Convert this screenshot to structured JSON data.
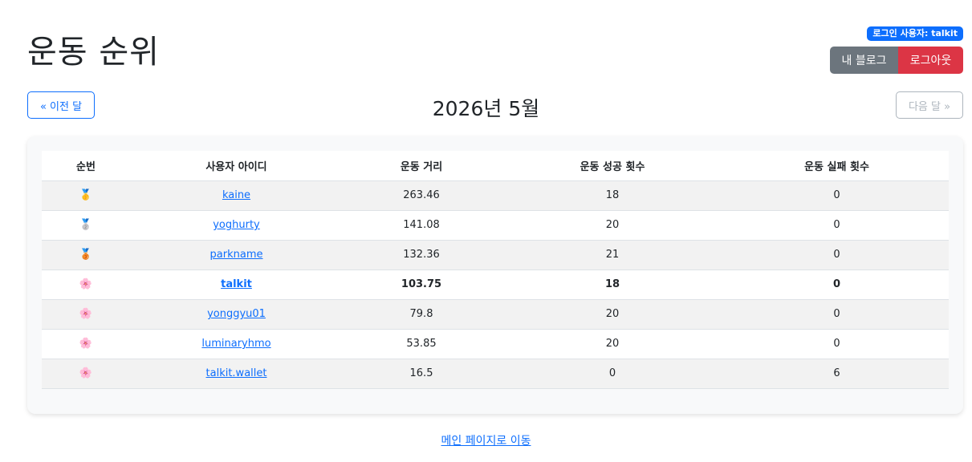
{
  "header": {
    "title": "운동 순위",
    "user_badge": "로그인 사용자: talkit",
    "blog_label": "내 블로그",
    "logout_label": "로그아웃"
  },
  "nav": {
    "prev_label": "« 이전 달",
    "month": "2026년 5월",
    "next_label": "다음 달 »"
  },
  "table": {
    "headers": [
      "순번",
      "사용자 아이디",
      "운동 거리",
      "운동 성공 횟수",
      "운동 실패 횟수"
    ],
    "rows": [
      {
        "rank": "🥇",
        "user": "kaine",
        "distance": "263.46",
        "success": "18",
        "fail": "0"
      },
      {
        "rank": "🥈",
        "user": "yoghurty",
        "distance": "141.08",
        "success": "20",
        "fail": "0"
      },
      {
        "rank": "🥉",
        "user": "parkname",
        "distance": "132.36",
        "success": "21",
        "fail": "0"
      },
      {
        "rank": "🌸",
        "user": "talkit",
        "distance": "103.75",
        "success": "18",
        "fail": "0"
      },
      {
        "rank": "🌸",
        "user": "yonggyu01",
        "distance": "79.8",
        "success": "20",
        "fail": "0"
      },
      {
        "rank": "🌸",
        "user": "luminaryhmo",
        "distance": "53.85",
        "success": "20",
        "fail": "0"
      },
      {
        "rank": "🌸",
        "user": "talkit.wallet",
        "distance": "16.5",
        "success": "0",
        "fail": "6"
      }
    ]
  },
  "footer": {
    "main_link": "메인 페이지로 이동"
  },
  "colors": {
    "primary": "#0d6efd",
    "secondary": "#6c757d",
    "danger": "#dc3545"
  }
}
